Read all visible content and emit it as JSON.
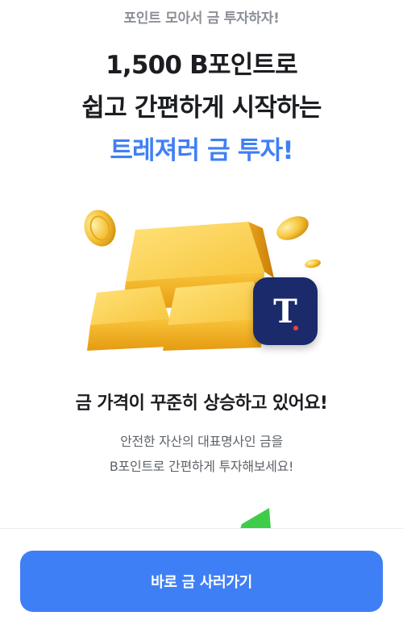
{
  "colors": {
    "accent": "#3f7ff6",
    "gold": "#f5b72b",
    "badge_bg": "#1a2a6b"
  },
  "promo": {
    "eyebrow": "포인트 모아서 금 투자하자!",
    "headline_line1": "1,500 B포인트로",
    "headline_line2": "쉽고 간편하게 시작하는",
    "headline_line3": "트레져러 금 투자!"
  },
  "hero": {
    "icon": "gold-bars-illustration",
    "badge_letter": "T",
    "badge_icon": "treasurer-logo-icon"
  },
  "info": {
    "title": "금 가격이 꾸준히 상승하고 있어요!",
    "desc_line1": "안전한 자산의 대표명사인 금을",
    "desc_line2": "B포인트로 간편하게 투자해보세요!"
  },
  "cta": {
    "label": "바로 금 사러가기"
  }
}
